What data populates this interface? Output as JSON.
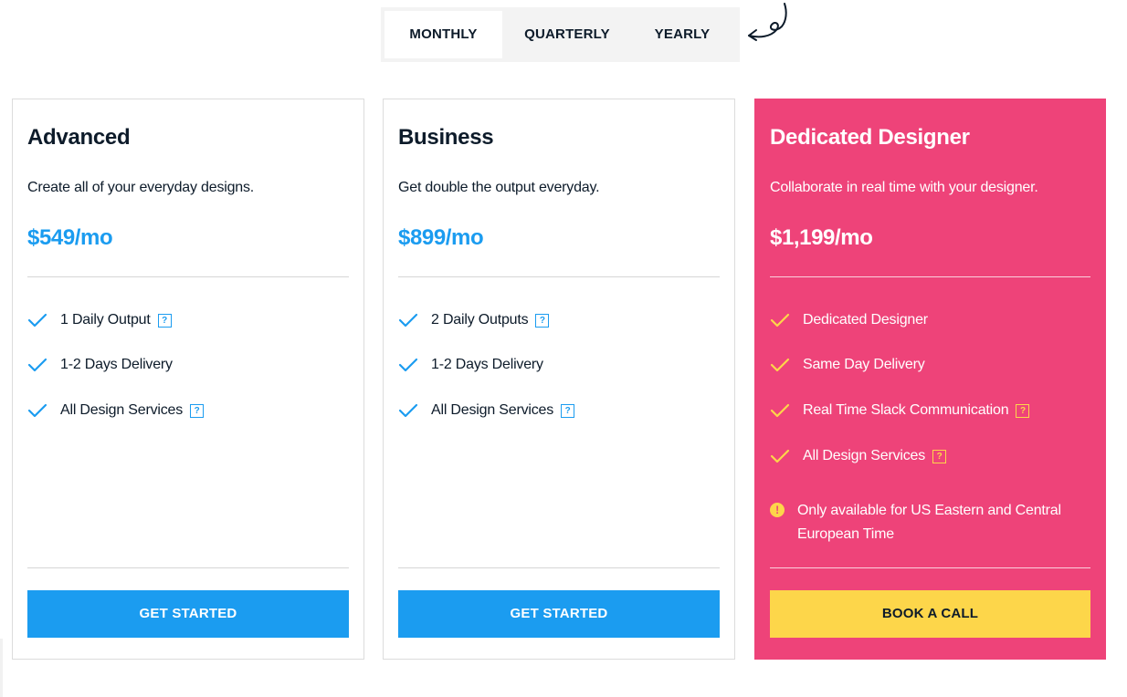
{
  "billing_toggle": {
    "options": [
      "MONTHLY",
      "QUARTERLY",
      "YEARLY"
    ],
    "selected": "MONTHLY"
  },
  "plans": [
    {
      "title": "Advanced",
      "description": "Create all of your everyday designs.",
      "price": "$549/mo",
      "features": [
        "1 Daily Output",
        "1-2 Days Delivery",
        "All Design Services"
      ],
      "button": "GET STARTED"
    },
    {
      "title": "Business",
      "description": "Get double the output everyday.",
      "price": "$899/mo",
      "features": [
        "2 Daily Outputs",
        "1-2 Days Delivery",
        "All Design Services"
      ],
      "button": "GET STARTED"
    },
    {
      "title": "Dedicated Designer",
      "description": "Collaborate in real time with your designer.",
      "price": "$1,199/mo",
      "features": [
        "Dedicated Designer",
        "Same Day Delivery",
        "Real Time Slack Communication",
        "All Design Services"
      ],
      "note": "Only available for US Eastern and Central European Time",
      "button": "BOOK A CALL"
    }
  ],
  "colors": {
    "accent_blue": "#1b9cf0",
    "highlight_pink": "#ee4379",
    "highlight_yellow": "#fdd64a",
    "text_dark": "#0d1b2a"
  },
  "icons": {
    "check": "check-icon",
    "help": "help-icon",
    "warning": "warning-icon",
    "arrow": "curly-arrow-icon"
  }
}
